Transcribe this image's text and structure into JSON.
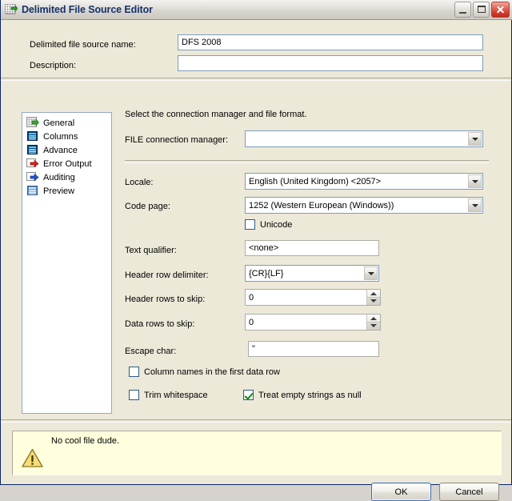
{
  "window": {
    "title": "Delimited File Source Editor",
    "app_icon": "grid-green-arrow-icon",
    "caption": {
      "minimize": "Minimize",
      "maximize": "Maximize",
      "close": "Close"
    }
  },
  "top_form": {
    "name_label": "Delimited file source name:",
    "name_value": "DFS 2008",
    "description_label": "Description:",
    "description_value": ""
  },
  "sidebar": {
    "items": [
      {
        "label": "General",
        "icon": "grid-green-arrow-icon"
      },
      {
        "label": "Columns",
        "icon": "blue-table-icon"
      },
      {
        "label": "Advance",
        "icon": "blue-table-icon"
      },
      {
        "label": "Error Output",
        "icon": "red-arrow-icon"
      },
      {
        "label": "Auditing",
        "icon": "blue-arrow-icon"
      },
      {
        "label": "Preview",
        "icon": "light-table-icon"
      }
    ]
  },
  "main": {
    "instruction": "Select the connection manager and file format.",
    "connection_manager_label": "FILE connection manager:",
    "connection_manager_value": "",
    "locale_label": "Locale:",
    "locale_value": "English (United Kingdom) <2057>",
    "code_page_label": "Code page:",
    "code_page_value": "1252 (Western European (Windows))",
    "unicode_label": "Unicode",
    "unicode_checked": false,
    "text_qualifier_label": "Text qualifier:",
    "text_qualifier_value": "<none>",
    "header_row_delimiter_label": "Header row delimiter:",
    "header_row_delimiter_value": "{CR}{LF}",
    "header_rows_to_skip_label": "Header rows to skip:",
    "header_rows_to_skip_value": "0",
    "data_rows_to_skip_label": "Data rows to skip:",
    "data_rows_to_skip_value": "0",
    "escape_char_label": "Escape char:",
    "escape_char_value": "\"",
    "column_names_label": "Column names in the first data row",
    "column_names_checked": false,
    "trim_whitespace_label": "Trim whitespace",
    "trim_whitespace_checked": false,
    "treat_empty_label": "Treat empty strings as null",
    "treat_empty_checked": true
  },
  "warning": {
    "icon": "warning-triangle-icon",
    "message": "No cool file dude.",
    "background": "#ffffdd"
  },
  "footer": {
    "ok_label": "OK",
    "cancel_label": "Cancel"
  },
  "colors": {
    "dialog_background": "#ece9d8",
    "title_text": "#15326b",
    "field_border": "#7f9db9",
    "warning_background": "#ffffdd",
    "check_green": "#0a8a12"
  }
}
